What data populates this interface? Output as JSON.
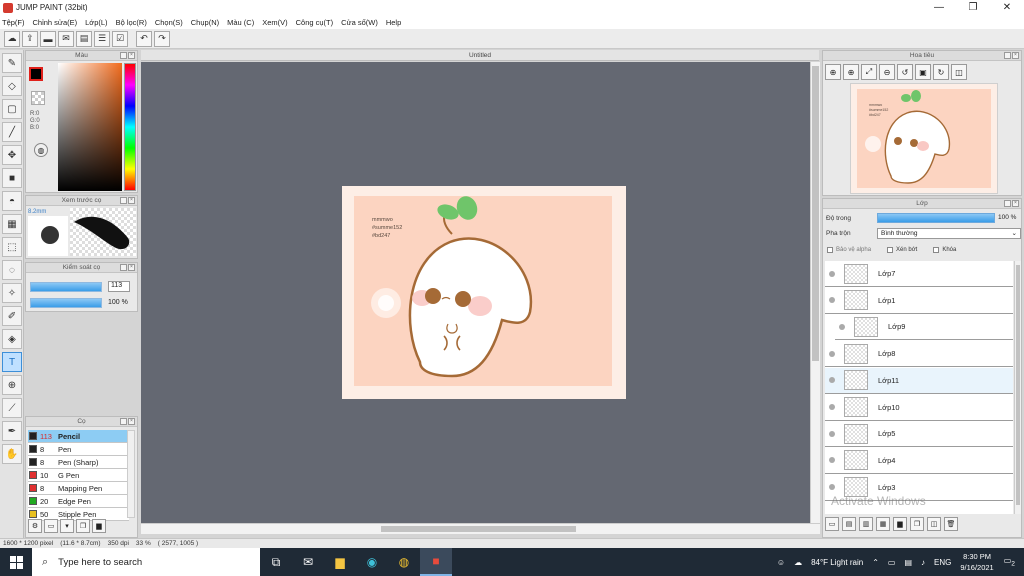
{
  "window": {
    "title": "JUMP PAINT (32bit)",
    "controls": [
      "—",
      "❐",
      "✕"
    ]
  },
  "menu": [
    "Tệp(F)",
    "Chỉnh sửa(E)",
    "Lớp(L)",
    "Bộ lọc(R)",
    "Chọn(S)",
    "Chụp(N)",
    "Màu (C)",
    "Xem(V)",
    "Công cụ(T)",
    "Cửa số(W)",
    "Help"
  ],
  "panels": {
    "color": {
      "title": "Màu",
      "rgb": [
        "R:0",
        "G:0",
        "B:0"
      ]
    },
    "preview": {
      "title": "Xem trước cọ",
      "size": "8.2mm"
    },
    "control": {
      "title": "Kiểm soát cọ",
      "size_value": "113",
      "opacity_value": "100 %"
    },
    "brush": {
      "title": "Cọ",
      "items": [
        {
          "size": "113",
          "name": "Pencil",
          "color": "#222222"
        },
        {
          "size": "8",
          "name": "Pen",
          "color": "#222222"
        },
        {
          "size": "8",
          "name": "Pen (Sharp)",
          "color": "#222222"
        },
        {
          "size": "10",
          "name": "G Pen",
          "color": "#e03030"
        },
        {
          "size": "8",
          "name": "Mapping Pen",
          "color": "#e03030"
        },
        {
          "size": "20",
          "name": "Edge Pen",
          "color": "#22aa22"
        },
        {
          "size": "50",
          "name": "Stipple Pen",
          "color": "#e8c020"
        }
      ]
    },
    "canvas": {
      "tab": "Untitled",
      "art_text": [
        "mmmwo",
        "#summe152",
        "#bd247"
      ]
    },
    "navigator": {
      "title": "Hoa tiêu"
    },
    "layers": {
      "title": "Lớp",
      "opacity_label": "Độ trong",
      "opacity_value": "100 %",
      "opacity_fraction": 1.0,
      "blend_label": "Pha trộn",
      "blend_value": "Bình thường",
      "checks": [
        "Bảo vệ alpha",
        "Xén bớt",
        "Khóa"
      ],
      "items": [
        "Lớp7",
        "Lớp1",
        "Lớp9",
        "Lớp8",
        "Lớp11",
        "Lớp10",
        "Lớp5",
        "Lớp4",
        "Lớp3"
      ],
      "selected": "Lớp11"
    }
  },
  "status": {
    "size": "1600 * 1200 pixel",
    "physical": "(11.6 * 8.7cm)",
    "dpi": "350 dpi",
    "zoom": "33 %",
    "coords": "( 2577, 1005 )"
  },
  "watermark": "Activate Windows",
  "taskbar": {
    "search_placeholder": "Type here to search",
    "weather": "84°F  Light rain",
    "lang": "ENG",
    "time": "8:30 PM",
    "date": "9/16/2021",
    "notif_count": "2"
  },
  "colors": {
    "artboard_bg": "#fdeee6",
    "artboard_inner": "#fcd4c1",
    "canvas_bg": "#646872",
    "accent": "#3a9de8",
    "leaf": "#6fc56a",
    "outline": "#a56a36"
  }
}
